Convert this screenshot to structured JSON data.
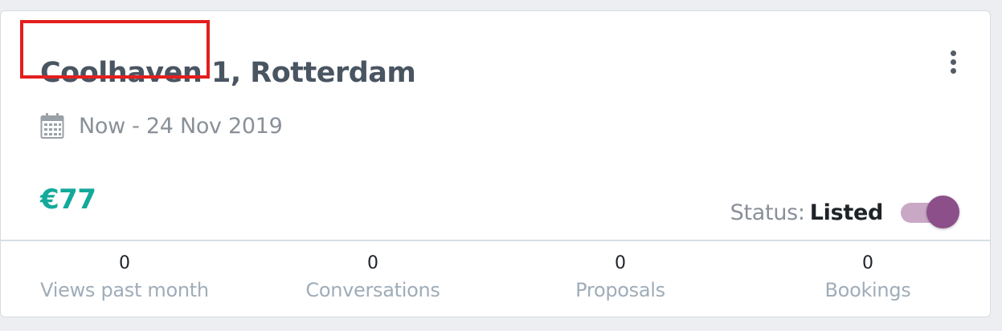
{
  "listing": {
    "title": "Coolhaven 1, Rotterdam",
    "date_range": "Now - 24 Nov 2019",
    "price": "€77",
    "status_label": "Status:",
    "status_value": "Listed",
    "status_toggle_on": true
  },
  "stats": [
    {
      "value": "0",
      "label": "Views past month"
    },
    {
      "value": "0",
      "label": "Conversations"
    },
    {
      "value": "0",
      "label": "Proposals"
    },
    {
      "value": "0",
      "label": "Bookings"
    }
  ],
  "icons": {
    "menu": "more-vertical-icon",
    "date": "calendar-icon"
  },
  "colors": {
    "title": "#4a5562",
    "price": "#13a99b",
    "toggle_track": "#c9a8c6",
    "toggle_knob": "#8c4f8a",
    "highlight": "#e41e1e"
  }
}
